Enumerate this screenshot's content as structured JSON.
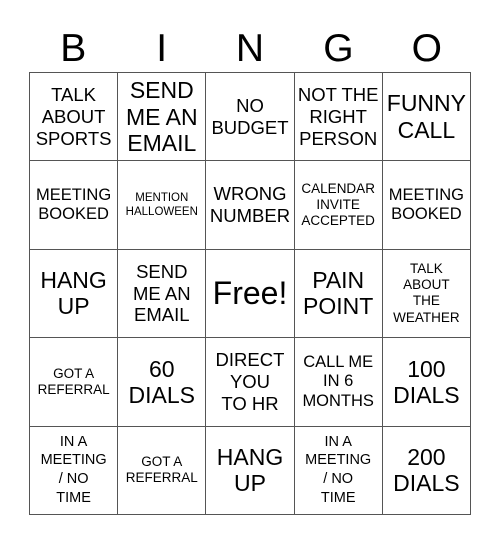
{
  "header": {
    "letters": [
      "B",
      "I",
      "N",
      "G",
      "O"
    ]
  },
  "board": {
    "rows": [
      [
        {
          "text": "TALK\nABOUT\nSPORTS",
          "size": "m"
        },
        {
          "text": "SEND\nME AN\nEMAIL",
          "size": "l"
        },
        {
          "text": "NO\nBUDGET",
          "size": "m"
        },
        {
          "text": "NOT THE\nRIGHT\nPERSON",
          "size": "m"
        },
        {
          "text": "FUNNY\nCALL",
          "size": "l"
        }
      ],
      [
        {
          "text": "MEETING\nBOOKED",
          "size": "ms"
        },
        {
          "text": "MENTION\nHALLOWEEN",
          "size": "xxs"
        },
        {
          "text": "WRONG\nNUMBER",
          "size": "m"
        },
        {
          "text": "CALENDAR\nINVITE\nACCEPTED",
          "size": "xs"
        },
        {
          "text": "MEETING\nBOOKED",
          "size": "ms"
        }
      ],
      [
        {
          "text": "HANG\nUP",
          "size": "l"
        },
        {
          "text": "SEND\nME AN\nEMAIL",
          "size": "m"
        },
        {
          "text": "Free!",
          "size": "xl"
        },
        {
          "text": "PAIN\nPOINT",
          "size": "l"
        },
        {
          "text": "TALK\nABOUT\nTHE\nWEATHER",
          "size": "xs"
        }
      ],
      [
        {
          "text": "GOT A\nREFERRAL",
          "size": "xs"
        },
        {
          "text": "60\nDIALS",
          "size": "l"
        },
        {
          "text": "DIRECT\nYOU\nTO HR",
          "size": "m"
        },
        {
          "text": "CALL ME\nIN 6\nMONTHS",
          "size": "ms"
        },
        {
          "text": "100\nDIALS",
          "size": "l"
        }
      ],
      [
        {
          "text": "IN A\nMEETING\n/ NO\nTIME",
          "size": "s"
        },
        {
          "text": "GOT A\nREFERRAL",
          "size": "xs"
        },
        {
          "text": "HANG\nUP",
          "size": "l"
        },
        {
          "text": "IN A\nMEETING\n/ NO\nTIME",
          "size": "s"
        },
        {
          "text": "200\nDIALS",
          "size": "l"
        }
      ]
    ]
  }
}
